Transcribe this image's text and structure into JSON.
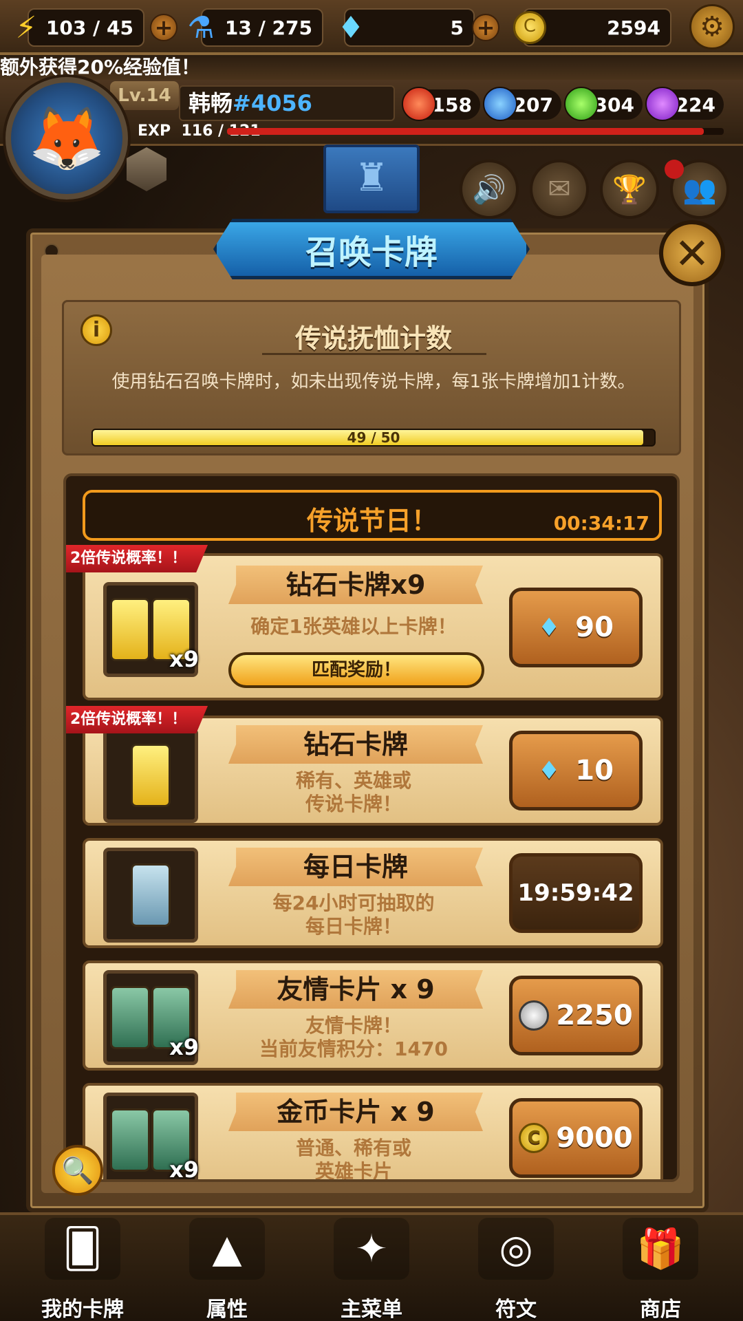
{
  "top": {
    "energy": "103 / 45",
    "potion": "13 / 275",
    "diamonds": "5",
    "gold": "2594"
  },
  "ticker": "额外获得20%经验值！",
  "profile": {
    "level": "Lv.14",
    "name": "韩畅",
    "tag": "#4056",
    "exp_label": "EXP",
    "exp_value": "116 / 121",
    "exp_fraction": 0.96,
    "fire": "158",
    "water": "207",
    "nature": "304",
    "dark": "224"
  },
  "dialog": {
    "title": "召唤卡牌",
    "pity_title": "传说抚恤计数",
    "pity_desc": "使用钻石召唤卡牌时，如未出现传说卡牌，每1张卡牌增加1计数。",
    "pity_progress": "49 / 50",
    "pity_fraction": 0.98
  },
  "festival": {
    "title": "传说节日！",
    "timer": "00:34:17"
  },
  "cards": [
    {
      "badge": "2倍传说概率！！",
      "title": "钻石卡牌x9",
      "desc": "确定1张英雄以上卡牌！",
      "match": "匹配奖励！",
      "price": "90",
      "count": "x9"
    },
    {
      "badge": "2倍传说概率！！",
      "title": "钻石卡牌",
      "desc1": "稀有、英雄或",
      "desc2": "传说卡牌！",
      "price": "10"
    },
    {
      "title": "每日卡牌",
      "desc1": "每24小时可抽取的",
      "desc2": "每日卡牌！",
      "timer": "19:59:42"
    },
    {
      "title": "友情卡片 x 9",
      "desc1": "友情卡牌！",
      "desc2": "当前友情积分：1470",
      "price": "2250",
      "count": "x9"
    },
    {
      "title": "金币卡片 x 9",
      "desc1": "普通、稀有或",
      "desc2": "英雄卡片",
      "price": "9000",
      "count": "x9"
    }
  ],
  "nav": {
    "my_cards": "我的卡牌",
    "attributes": "属性",
    "main_menu": "主菜单",
    "runes": "符文",
    "shop": "商店"
  },
  "colors": {
    "accent_blue": "#1560a8",
    "festival_orange": "#f29a1c",
    "badge_red": "#d0211a"
  }
}
